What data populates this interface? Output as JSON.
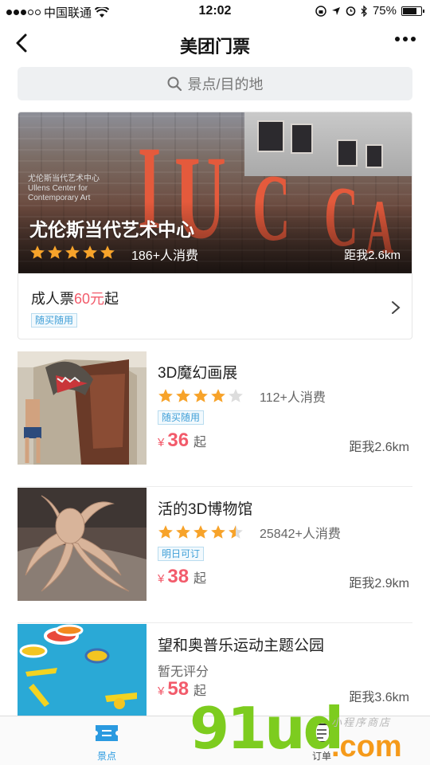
{
  "status_bar": {
    "carrier": "中国联通",
    "time": "12:02",
    "battery": "75%"
  },
  "nav": {
    "title": "美团门票"
  },
  "search": {
    "placeholder": "景点/目的地"
  },
  "featured": {
    "name": "尤伦斯当代艺术中心",
    "rating": 5,
    "consumers": "186+人消费",
    "distance": "距我2.6km",
    "ticket_prefix": "成人票",
    "ticket_price": "60元",
    "ticket_suffix": "起",
    "tag": "随买随用",
    "sign_text": "尤伦斯当代艺术中心 Ullens Center for Contemporary Art"
  },
  "items": [
    {
      "name": "3D魔幻画展",
      "rating": 4,
      "consumers": "112+人消费",
      "tag": "随买随用",
      "currency": "¥",
      "price": "36",
      "price_suffix": "起",
      "distance": "距我2.6km"
    },
    {
      "name": "活的3D博物馆",
      "rating": 4.5,
      "consumers": "25842+人消费",
      "tag": "明日可订",
      "currency": "¥",
      "price": "38",
      "price_suffix": "起",
      "distance": "距我2.9km"
    },
    {
      "name": "望和奥普乐运动主题公园",
      "rating_text": "暂无评分",
      "currency": "¥",
      "price": "58",
      "price_suffix": "起",
      "distance": "距我3.6km"
    }
  ],
  "tabbar": {
    "tabs": [
      {
        "label": "景点",
        "icon": "ticket-icon",
        "active": true
      },
      {
        "label": "订单",
        "icon": "order-list-icon",
        "active": false
      }
    ]
  },
  "watermark": {
    "main": "91ud",
    "com": ".com",
    "sub": "小程序商店"
  },
  "colors": {
    "price": "#f25b6b",
    "star": "#f7a32a",
    "tag_text": "#41a0d8",
    "tab_active": "#2a9ae0"
  }
}
